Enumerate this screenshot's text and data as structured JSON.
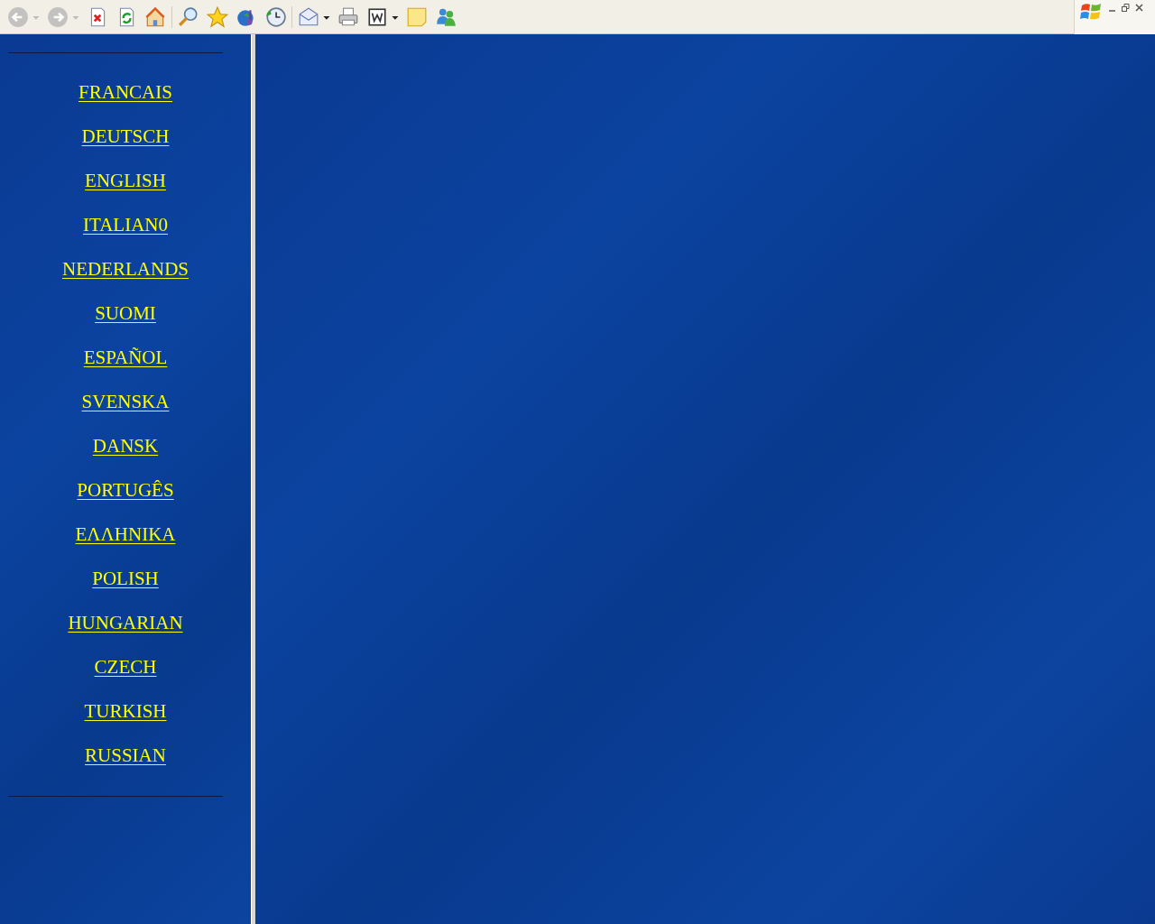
{
  "toolbar": {
    "buttons": [
      {
        "kind": "back",
        "disabled": true,
        "dropdown": true
      },
      {
        "kind": "forward",
        "disabled": true,
        "dropdown": true
      },
      {
        "kind": "stop",
        "disabled": false,
        "dropdown": false
      },
      {
        "kind": "refresh",
        "disabled": false,
        "dropdown": false
      },
      {
        "kind": "home",
        "disabled": false,
        "dropdown": false
      },
      {
        "kind": "search",
        "disabled": false,
        "dropdown": false
      },
      {
        "kind": "favorites",
        "disabled": false,
        "dropdown": false
      },
      {
        "kind": "media",
        "disabled": false,
        "dropdown": false
      },
      {
        "kind": "history",
        "disabled": false,
        "dropdown": false
      },
      {
        "kind": "mail",
        "disabled": false,
        "dropdown": true
      },
      {
        "kind": "print",
        "disabled": false,
        "dropdown": false
      },
      {
        "kind": "edit",
        "disabled": false,
        "dropdown": true
      },
      {
        "kind": "notes",
        "disabled": false,
        "dropdown": false
      },
      {
        "kind": "messenger",
        "disabled": false,
        "dropdown": false
      }
    ]
  },
  "languages": [
    "FRANCAIS",
    "DEUTSCH",
    "ENGLISH",
    "ITALIAN0",
    "NEDERLANDS",
    "SUOMI",
    "ESPAÑOL",
    "SVENSKA",
    "DANSK",
    "PORTUGÊS",
    "ΕΛΛΗΝΙΚΑ",
    "POLISH",
    "HUNGARIAN",
    "CZECH",
    "TURKISH",
    "RUSSIAN"
  ]
}
